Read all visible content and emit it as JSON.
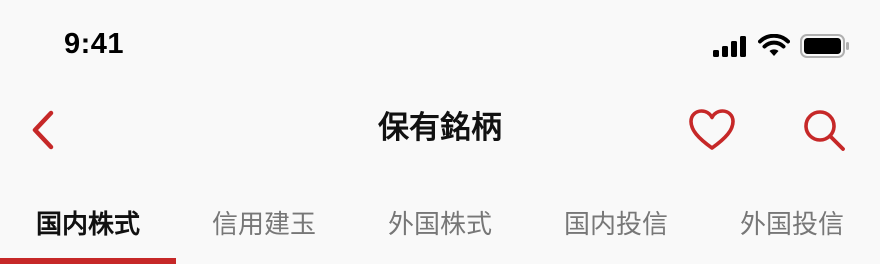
{
  "status_bar": {
    "time": "9:41"
  },
  "nav": {
    "title": "保有銘柄",
    "back_icon": "chevron-left-icon",
    "favorite_icon": "heart-icon",
    "search_icon": "search-icon"
  },
  "tabs": [
    {
      "label": "国内株式",
      "active": true
    },
    {
      "label": "信用建玉",
      "active": false
    },
    {
      "label": "外国株式",
      "active": false
    },
    {
      "label": "国内投信",
      "active": false
    },
    {
      "label": "外国投信",
      "active": false
    }
  ],
  "colors": {
    "accent": "#c62828",
    "background": "#f9f9f9",
    "text_primary": "#111111",
    "text_secondary": "#777777"
  }
}
